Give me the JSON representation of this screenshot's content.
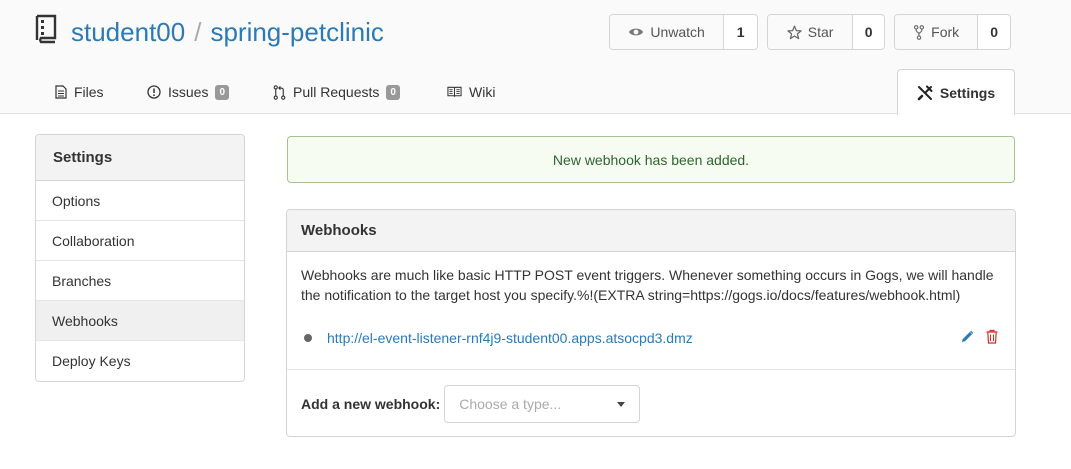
{
  "repo": {
    "owner": "student00",
    "separator": "/",
    "name": "spring-petclinic"
  },
  "actions": {
    "watch": {
      "label": "Unwatch",
      "count": "1"
    },
    "star": {
      "label": "Star",
      "count": "0"
    },
    "fork": {
      "label": "Fork",
      "count": "0"
    }
  },
  "tabs": [
    {
      "label": "Files"
    },
    {
      "label": "Issues",
      "badge": "0"
    },
    {
      "label": "Pull Requests",
      "badge": "0"
    },
    {
      "label": "Wiki"
    }
  ],
  "settings_tab": {
    "label": "Settings"
  },
  "sidebar": {
    "title": "Settings",
    "items": [
      {
        "label": "Options"
      },
      {
        "label": "Collaboration"
      },
      {
        "label": "Branches"
      },
      {
        "label": "Webhooks",
        "active": true
      },
      {
        "label": "Deploy Keys"
      }
    ]
  },
  "flash": {
    "message": "New webhook has been added."
  },
  "webhooks": {
    "title": "Webhooks",
    "description": "Webhooks are much like basic HTTP POST event triggers. Whenever something occurs in Gogs, we will handle the notification to the target host you specify.%!(EXTRA string=https://gogs.io/docs/features/webhook.html)",
    "hooks": [
      {
        "url": "http://el-event-listener-rnf4j9-student00.apps.atsocpd3.dmz"
      }
    ],
    "add_label": "Add a new webhook:",
    "type_placeholder": "Choose a type..."
  },
  "colors": {
    "link": "#2a7ab8",
    "success_text": "#2c662d",
    "success_bg": "#f7fcf3",
    "delete": "#db2828"
  }
}
